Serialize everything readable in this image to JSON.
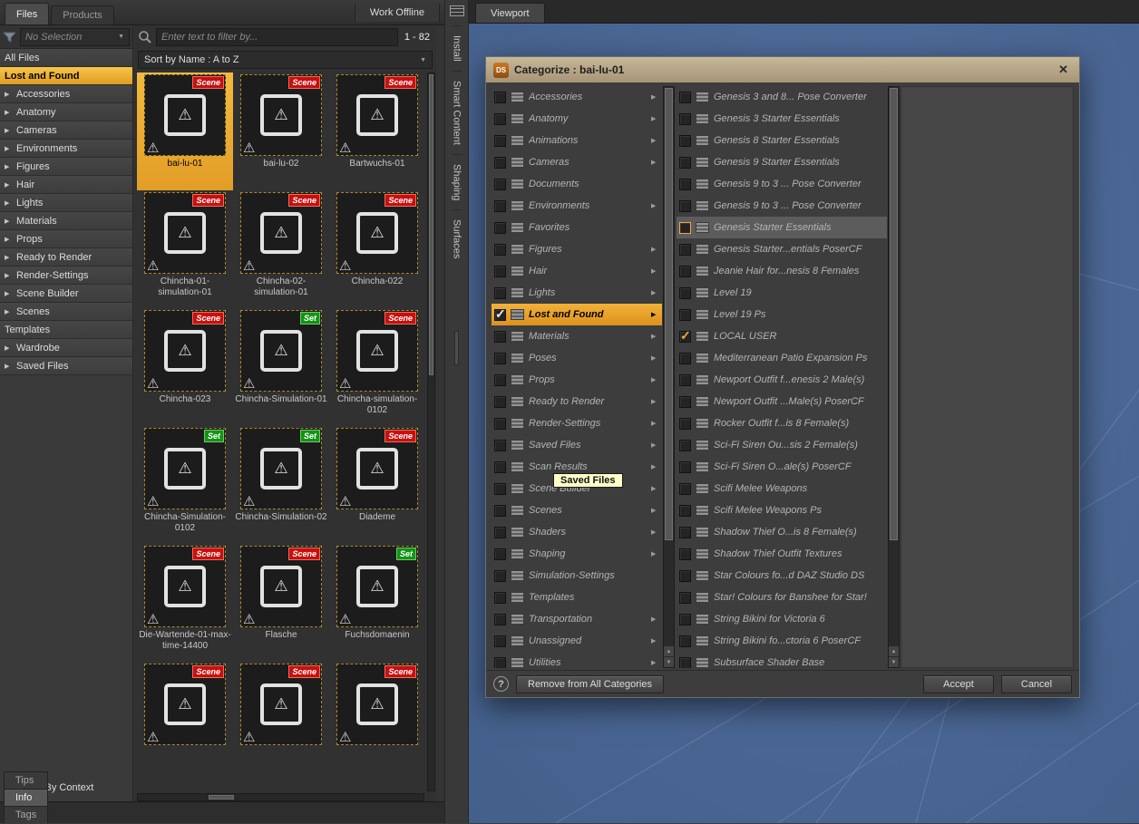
{
  "top_bar": {
    "tabs": [
      {
        "label": "Files",
        "active": true
      },
      {
        "label": "Products",
        "active": false
      }
    ],
    "work_offline_label": "Work Offline"
  },
  "sidebar": {
    "filter_dropdown": "No Selection",
    "filter_by_context": "Filter By Context",
    "items": [
      {
        "label": "All Files",
        "arrow": false,
        "selected": false
      },
      {
        "label": "Lost and Found",
        "arrow": false,
        "selected": true
      },
      {
        "label": "Accessories",
        "arrow": true
      },
      {
        "label": "Anatomy",
        "arrow": true
      },
      {
        "label": "Cameras",
        "arrow": true
      },
      {
        "label": "Environments",
        "arrow": true
      },
      {
        "label": "Figures",
        "arrow": true
      },
      {
        "label": "Hair",
        "arrow": true
      },
      {
        "label": "Lights",
        "arrow": true
      },
      {
        "label": "Materials",
        "arrow": true
      },
      {
        "label": "Props",
        "arrow": true
      },
      {
        "label": "Ready to Render",
        "arrow": true
      },
      {
        "label": "Render-Settings",
        "arrow": true
      },
      {
        "label": "Scene Builder",
        "arrow": true
      },
      {
        "label": "Scenes",
        "arrow": true
      },
      {
        "label": "Templates",
        "arrow": false
      },
      {
        "label": "Wardrobe",
        "arrow": true
      },
      {
        "label": "Saved Files",
        "arrow": true
      }
    ]
  },
  "content_panel": {
    "search_placeholder": "Enter text to filter by...",
    "count": "1 - 82",
    "sort_label": "Sort by Name : A to Z",
    "thumbnails": [
      {
        "label": "bai-lu-01",
        "badge": "Scene",
        "selected": true
      },
      {
        "label": "bai-lu-02",
        "badge": "Scene"
      },
      {
        "label": "Bartwuchs-01",
        "badge": "Scene"
      },
      {
        "label": "Chincha-01-simulation-01",
        "badge": "Scene"
      },
      {
        "label": "Chincha-02-simulation-01",
        "badge": "Scene"
      },
      {
        "label": "Chincha-022",
        "badge": "Scene"
      },
      {
        "label": "Chincha-023",
        "badge": "Scene"
      },
      {
        "label": "Chincha-Simulation-01",
        "badge": "Set"
      },
      {
        "label": "Chincha-simulation-0102",
        "badge": "Scene"
      },
      {
        "label": "Chincha-Simulation-0102",
        "badge": "Set"
      },
      {
        "label": "Chincha-Simulation-02",
        "badge": "Set"
      },
      {
        "label": "Diademe",
        "badge": "Scene"
      },
      {
        "label": "Die-Wartende-01-max-time-14400",
        "badge": "Scene"
      },
      {
        "label": "Flasche",
        "badge": "Scene"
      },
      {
        "label": "Fuchsdomaenin",
        "badge": "Set"
      },
      {
        "label": "",
        "badge": "Scene"
      },
      {
        "label": "",
        "badge": "Scene"
      },
      {
        "label": "",
        "badge": "Scene"
      }
    ]
  },
  "side_tabs": [
    "Install",
    "Smart Content",
    "Shaping",
    "Surfaces"
  ],
  "viewport": {
    "tab_label": "Viewport"
  },
  "bottom_tabs": [
    {
      "label": "Tips",
      "active": false
    },
    {
      "label": "Info",
      "active": true
    },
    {
      "label": "Tags",
      "active": false
    }
  ],
  "dialog": {
    "logo_text": "DS",
    "title": "Categorize : bai-lu-01",
    "tooltip": "Saved Files",
    "help_label": "?",
    "remove_button": "Remove from All Categories",
    "accept_button": "Accept",
    "cancel_button": "Cancel",
    "left_items": [
      {
        "label": "Accessories",
        "arrow": true
      },
      {
        "label": "Anatomy",
        "arrow": true
      },
      {
        "label": "Animations",
        "arrow": true
      },
      {
        "label": "Cameras",
        "arrow": true
      },
      {
        "label": "Documents",
        "arrow": false
      },
      {
        "label": "Environments",
        "arrow": true
      },
      {
        "label": "Favorites",
        "arrow": false
      },
      {
        "label": "Figures",
        "arrow": true
      },
      {
        "label": "Hair",
        "arrow": true
      },
      {
        "label": "Lights",
        "arrow": true
      },
      {
        "label": "Lost and Found",
        "arrow": true,
        "checked": true,
        "highlight": true
      },
      {
        "label": "Materials",
        "arrow": true
      },
      {
        "label": "Poses",
        "arrow": true
      },
      {
        "label": "Props",
        "arrow": true
      },
      {
        "label": "Ready to Render",
        "arrow": true
      },
      {
        "label": "Render-Settings",
        "arrow": true
      },
      {
        "label": "Saved Files",
        "arrow": true
      },
      {
        "label": "Scan Results",
        "arrow": true
      },
      {
        "label": "Scene Builder",
        "arrow": true
      },
      {
        "label": "Scenes",
        "arrow": true
      },
      {
        "label": "Shaders",
        "arrow": true
      },
      {
        "label": "Shaping",
        "arrow": true
      },
      {
        "label": "Simulation-Settings",
        "arrow": false
      },
      {
        "label": "Templates",
        "arrow": false
      },
      {
        "label": "Transportation",
        "arrow": true
      },
      {
        "label": "Unassigned",
        "arrow": true
      },
      {
        "label": "Utilities",
        "arrow": true
      }
    ],
    "right_items": [
      {
        "label": "Genesis 3 and 8... Pose Converter"
      },
      {
        "label": "Genesis 3 Starter Essentials"
      },
      {
        "label": "Genesis 8 Starter Essentials"
      },
      {
        "label": "Genesis 9 Starter Essentials"
      },
      {
        "label": "Genesis 9 to 3 ... Pose Converter"
      },
      {
        "label": "Genesis 9 to 3 ... Pose Converter"
      },
      {
        "label": "Genesis Starter Essentials",
        "rowsel": true,
        "focusbox": true
      },
      {
        "label": "Genesis Starter...entials PoserCF"
      },
      {
        "label": "Jeanie Hair for...nesis 8 Females"
      },
      {
        "label": "Level 19"
      },
      {
        "label": "Level 19 Ps"
      },
      {
        "label": "LOCAL USER",
        "checked": true,
        "check": "orange"
      },
      {
        "label": "Mediterranean Patio Expansion Ps"
      },
      {
        "label": "Newport Outfit f...enesis 2 Male(s)"
      },
      {
        "label": "Newport Outfit ...Male(s) PoserCF"
      },
      {
        "label": "Rocker Outfit f...is 8 Female(s)"
      },
      {
        "label": "Sci-Fi Siren Ou...sis 2 Female(s)"
      },
      {
        "label": "Sci-Fi Siren O...ale(s) PoserCF"
      },
      {
        "label": "Scifi Melee Weapons"
      },
      {
        "label": "Scifi Melee Weapons Ps"
      },
      {
        "label": "Shadow Thief O...is 8 Female(s)"
      },
      {
        "label": "Shadow Thief Outfit Textures"
      },
      {
        "label": "Star Colours fo...d DAZ Studio DS"
      },
      {
        "label": "Star! Colours for Banshee for Star!"
      },
      {
        "label": "String Bikini for Victoria 6"
      },
      {
        "label": "String Bikini fo...ctoria 6 PoserCF"
      },
      {
        "label": "Subsurface Shader Base"
      }
    ]
  },
  "colors": {
    "accent_orange": "#e9a93a",
    "badge_scene": "#c90f0f",
    "badge_set": "#149314",
    "dialog_titlebar": "#b9aa89",
    "viewport_blue": "#4a6693"
  }
}
